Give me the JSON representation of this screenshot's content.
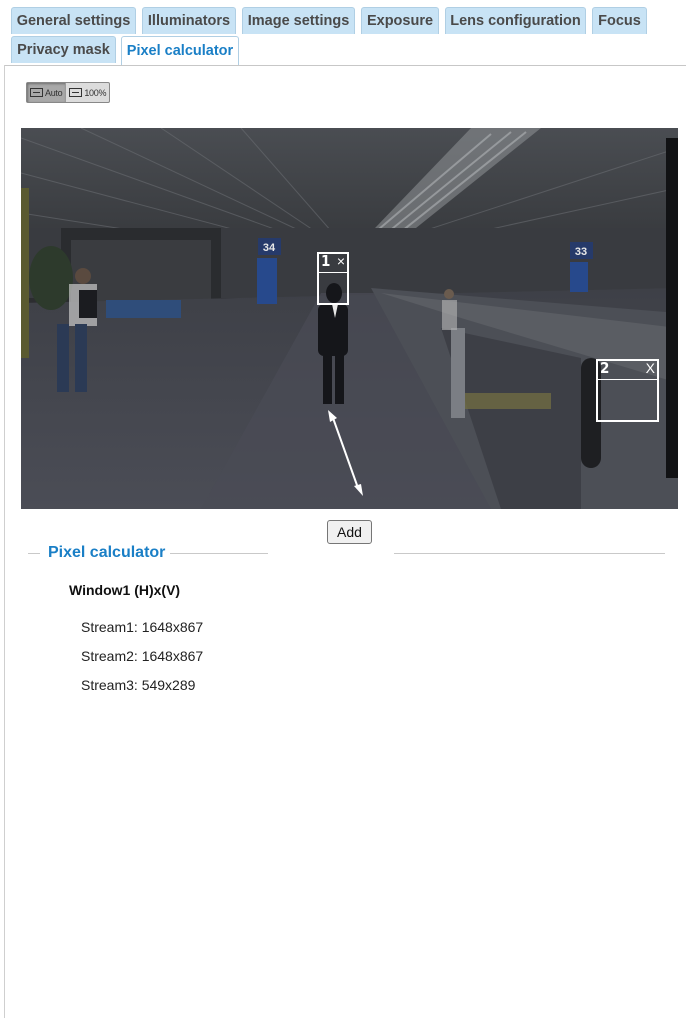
{
  "tabs": [
    {
      "label": "General settings",
      "active": false
    },
    {
      "label": "Illuminators",
      "active": false
    },
    {
      "label": "Image settings",
      "active": false
    },
    {
      "label": "Exposure",
      "active": false
    },
    {
      "label": "Lens configuration",
      "active": false
    },
    {
      "label": "Focus",
      "active": false
    },
    {
      "label": "Privacy mask",
      "active": false
    },
    {
      "label": "Pixel calculator",
      "active": true
    }
  ],
  "zoom": {
    "auto_label": "Auto",
    "full_label": "100%",
    "selected": "Auto"
  },
  "video": {
    "windows": [
      {
        "label": "1",
        "close": "×"
      },
      {
        "label": "2",
        "close": "X"
      }
    ],
    "signs": [
      "34",
      "33"
    ]
  },
  "add_button": "Add",
  "pixel_calculator": {
    "legend": "Pixel calculator",
    "window_heading": "Window1 (H)x(V)",
    "streams": [
      "Stream1: 1648x867",
      "Stream2: 1648x867",
      "Stream3: 549x289"
    ]
  },
  "colors": {
    "accent": "#1a7fc6",
    "tab_bg": "#c8e3f5"
  }
}
